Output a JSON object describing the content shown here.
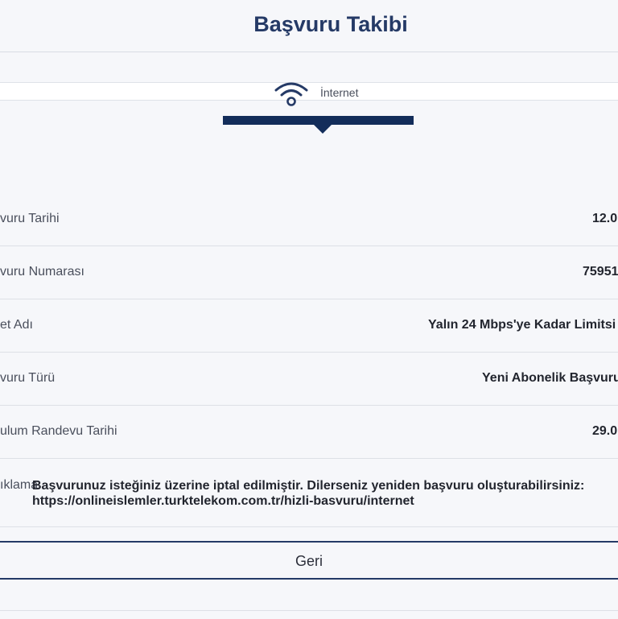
{
  "header": {
    "title": "Başvuru Takibi"
  },
  "tab": {
    "label": "İnternet",
    "icon": "wifi-icon"
  },
  "details": {
    "date_label": "vuru Tarihi",
    "date_value": "12.0",
    "number_label": "vuru Numarası",
    "number_value": "75951",
    "package_label": "et Adı",
    "package_value": "Yalın 24 Mbps'ye Kadar Limitsi",
    "type_label": "vuru Türü",
    "type_value": "Yeni Abonelik Başvuru",
    "install_label": "ulum Randevu Tarihi",
    "install_value": "29.0",
    "desc_label": "ıklama",
    "desc_value": "Başvurunuz isteğiniz üzerine iptal edilmiştir. Dilerseniz yeniden başvuru oluşturabilirsiniz: https://onlineislemler.turktelekom.com.tr/hizli-basvuru/internet"
  },
  "actions": {
    "back_label": "Geri"
  },
  "colors": {
    "accent": "#132d5a",
    "title": "#253a66",
    "background": "#f6f7fa"
  }
}
